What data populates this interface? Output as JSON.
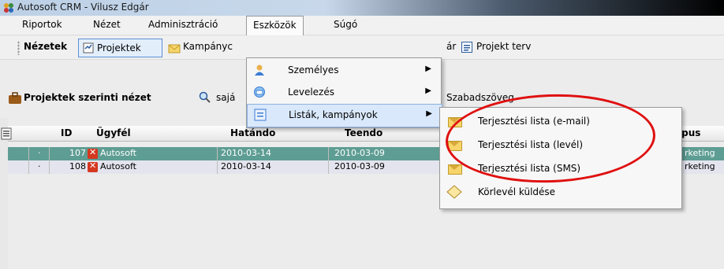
{
  "window": {
    "title": "Autosoft CRM - Vilusz Edgár"
  },
  "menubar": {
    "items": [
      "Riportok",
      "Nézet",
      "Adminisztráció",
      "Eszközök",
      "Súgó"
    ]
  },
  "toolbar1": {
    "nezetek": "Nézetek",
    "projektek": "Projektek",
    "kampanyok": "Kampányc",
    "partial_ar": "ár",
    "projekt_terv": "Projekt terv"
  },
  "toolbar2": {
    "view_label": "Projektek szerinti nézet",
    "saja": "sajá",
    "szabadszoveg": "Szabadszöveg"
  },
  "grid": {
    "headers": {
      "id": "ID",
      "ugyfel": "Ügyfél",
      "hatando": "Hatándo",
      "teendo": "Teendo",
      "tipus": "ípus"
    },
    "rows": [
      {
        "marker": "·",
        "id": "107",
        "ugyfel": "Autosoft",
        "hatando": "2010-03-14",
        "teendo": "2010-03-09",
        "tipus": "rketing"
      },
      {
        "marker": "·",
        "id": "108",
        "ugyfel": "Autosoft",
        "hatando": "2010-03-14",
        "teendo": "2010-03-09",
        "tipus": "rketing"
      }
    ]
  },
  "dropdown": {
    "items": [
      {
        "label": "Személyes",
        "icon": "person-icon",
        "has_submenu": true
      },
      {
        "label": "Levelezés",
        "icon": "mail-icon",
        "has_submenu": true
      },
      {
        "label": "Listák, kampányok",
        "icon": "list-icon",
        "has_submenu": true
      }
    ]
  },
  "submenu": {
    "items": [
      {
        "label": "Terjesztési lista (e-mail)",
        "icon": "envelope-icon"
      },
      {
        "label": "Terjesztési lista (levél)",
        "icon": "envelope-icon"
      },
      {
        "label": "Terjesztési lista (SMS)",
        "icon": "envelope-icon"
      },
      {
        "label": "Körlevél küldése",
        "icon": "letter-icon"
      }
    ]
  },
  "colors": {
    "selected_row": "#5e9d93",
    "highlight": "#d9e8fb",
    "annotation": "#e01010"
  }
}
